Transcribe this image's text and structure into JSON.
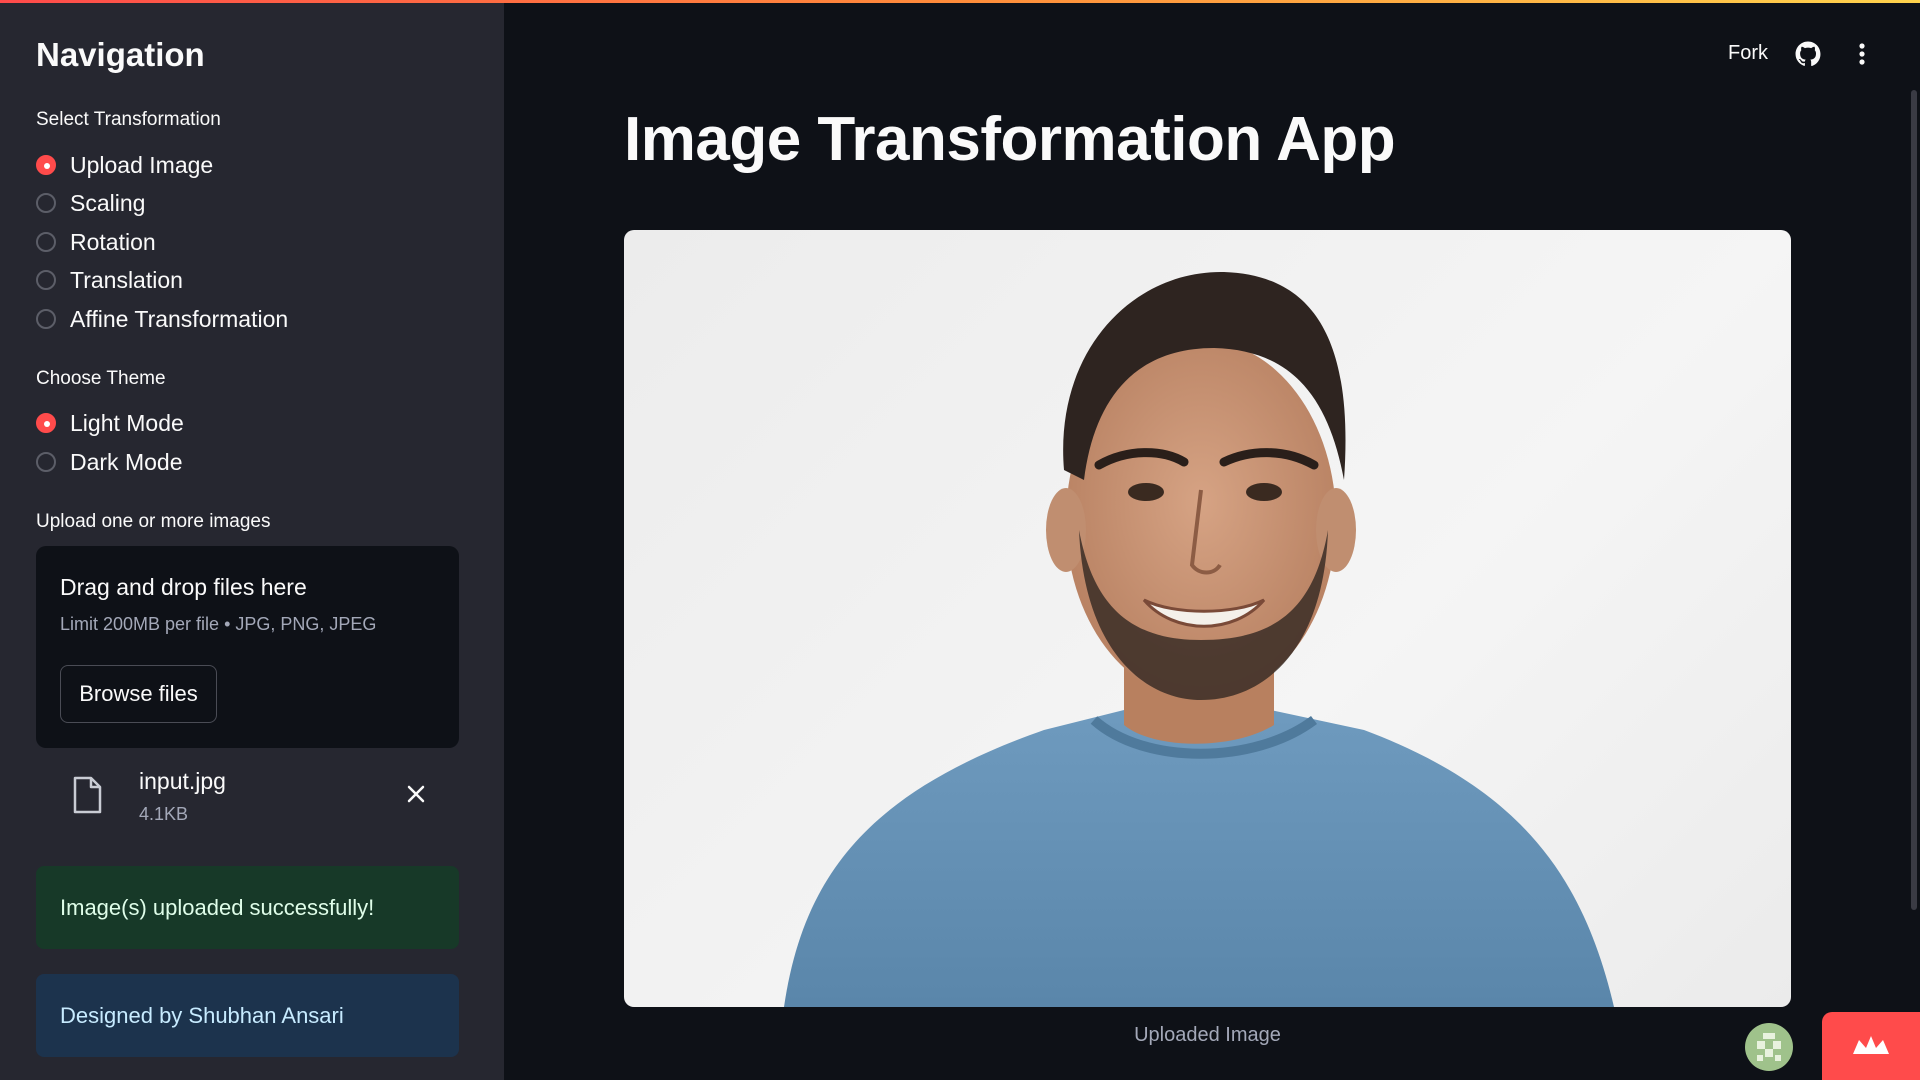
{
  "sidebar": {
    "title": "Navigation",
    "transform_label": "Select Transformation",
    "transform_options": [
      {
        "label": "Upload Image",
        "checked": true
      },
      {
        "label": "Scaling",
        "checked": false
      },
      {
        "label": "Rotation",
        "checked": false
      },
      {
        "label": "Translation",
        "checked": false
      },
      {
        "label": "Affine Transformation",
        "checked": false
      }
    ],
    "theme_label": "Choose Theme",
    "theme_options": [
      {
        "label": "Light Mode",
        "checked": true
      },
      {
        "label": "Dark Mode",
        "checked": false
      }
    ],
    "upload_label": "Upload one or more images",
    "dropzone": {
      "title": "Drag and drop files here",
      "subtitle": "Limit 200MB per file • JPG, PNG, JPEG",
      "browse_label": "Browse files"
    },
    "file": {
      "name": "input.jpg",
      "size": "4.1KB",
      "icon": "file-icon"
    },
    "success_message": "Image(s) uploaded successfully!",
    "info_message": "Designed by Shubhan Ansari"
  },
  "header": {
    "fork_label": "Fork",
    "icons": [
      "github-icon",
      "kebab-menu-icon"
    ]
  },
  "main": {
    "title": "Image Transformation App",
    "image_caption": "Uploaded Image"
  },
  "colors": {
    "accent": "#ff4b4b",
    "sidebar_bg": "#262730",
    "main_bg": "#0e1117",
    "success_bg": "#173928",
    "info_bg": "#1c334d"
  }
}
